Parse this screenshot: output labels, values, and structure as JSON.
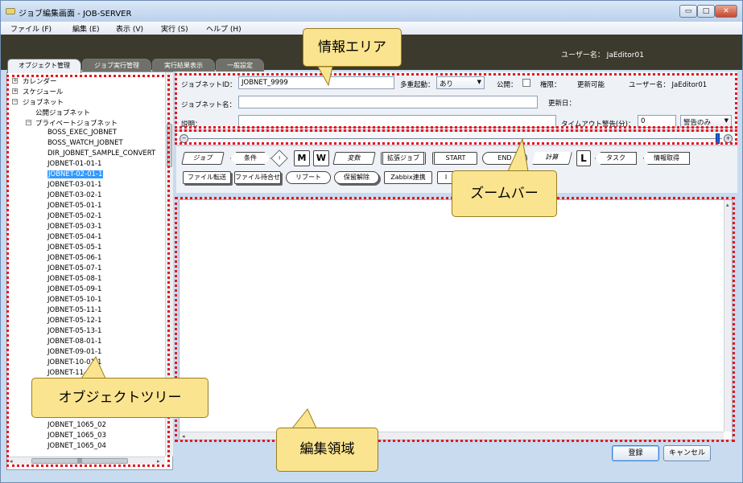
{
  "window": {
    "title": "ジョブ編集画面 - JOB-SERVER",
    "controls": {
      "minimize": "▭",
      "maximize": "□",
      "close": "✕"
    }
  },
  "menu": [
    "ファイル (F)",
    "編集 (E)",
    "表示 (V)",
    "実行 (S)",
    "ヘルプ (H)"
  ],
  "header": {
    "user_label": "ユーザー名： JaEditor01"
  },
  "tabs": [
    "オブジェクト管理",
    "ジョブ実行管理",
    "実行結果表示",
    "一般設定"
  ],
  "tree": {
    "top_nodes": [
      {
        "expander": "+",
        "label": "カレンダー"
      },
      {
        "expander": "+",
        "label": "スケジュール"
      },
      {
        "expander": "−",
        "label": "ジョブネット"
      }
    ],
    "public_label": "公開ジョブネット",
    "private_expander": "−",
    "private_label": "プライベートジョブネット",
    "items": [
      "BOSS_EXEC_JOBNET",
      "BOSS_WATCH_JOBNET",
      "DIR_JOBNET_SAMPLE_CONVERT",
      "JOBNET-01-01-1",
      "JOBNET-02-01-1",
      "JOBNET-03-01-1",
      "JOBNET-03-02-1",
      "JOBNET-05-01-1",
      "JOBNET-05-02-1",
      "JOBNET-05-03-1",
      "JOBNET-05-04-1",
      "JOBNET-05-05-1",
      "JOBNET-05-06-1",
      "JOBNET-05-07-1",
      "JOBNET-05-08-1",
      "JOBNET-05-09-1",
      "JOBNET-05-10-1",
      "JOBNET-05-11-1",
      "JOBNET-05-12-1",
      "JOBNET-05-13-1",
      "JOBNET-08-01-1",
      "JOBNET-09-01-1",
      "JOBNET-10-01-1",
      "JOBNET-11-01-1"
    ],
    "bottom_items": [
      "JOBNET_1065_02",
      "JOBNET_1065_03",
      "JOBNET_1065_04"
    ],
    "selected": "JOBNET-02-01-1",
    "hscroll_thumb": "|||"
  },
  "info": {
    "jobnet_id_label": "ジョブネットID：",
    "jobnet_id_value": "JOBNET_9999",
    "multi_start_label": "多重起動：",
    "multi_start_value": "あり",
    "public_label": "公開：",
    "authority_label": "権限：",
    "authority_value": "更新可能",
    "user_label": "ユーザー名： JaEditor01",
    "jobnet_name_label": "ジョブネット名：",
    "update_date_label": "更新日：",
    "description_label": "説明：",
    "timeout_label": "タイムアウト警告(分)：",
    "timeout_value": "0",
    "warning_value": "警告のみ"
  },
  "zoom": {
    "minus": "−",
    "plus": "+"
  },
  "palette": {
    "row1": [
      "ジョブ",
      "条件",
      "I",
      "M",
      "W",
      "変数",
      "拡張ジョブ",
      "START",
      "END",
      "計算",
      "L",
      "タスク",
      "情報取得"
    ],
    "row2": [
      "ファイル転送",
      "ファイル待合せ",
      "リブート",
      "保留解除",
      "Zabbix連携",
      "I"
    ]
  },
  "buttons": {
    "register": "登録",
    "cancel": "キャンセル"
  },
  "callouts": {
    "info_area": "情報エリア",
    "zoom_bar": "ズームバー",
    "object_tree": "オブジェクトツリー",
    "edit_area": "編集領域"
  },
  "colors": {
    "annotation": "#e8141c",
    "callout": "#fbe48f",
    "selection": "#3399ff",
    "header_band": "#3c3a2c"
  }
}
